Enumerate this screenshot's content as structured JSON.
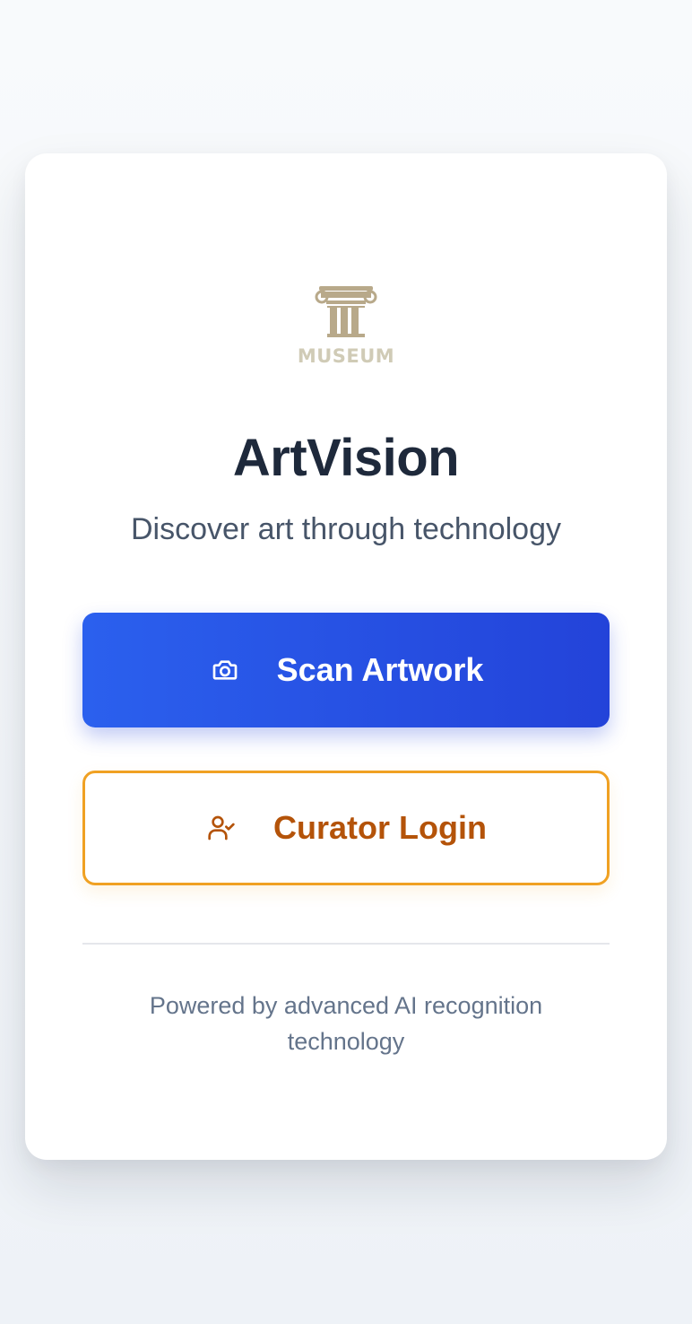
{
  "app": {
    "title": "ArtVision",
    "subtitle": "Discover art through technology"
  },
  "logo": {
    "text": "MUSEUM",
    "icon": "column-icon",
    "color": "#b8a98a"
  },
  "actions": {
    "scan": {
      "label": "Scan Artwork",
      "icon": "camera-icon"
    },
    "curator": {
      "label": "Curator Login",
      "icon": "user-check-icon"
    }
  },
  "footer": {
    "text": "Powered by advanced AI recognition technology"
  },
  "colors": {
    "primary": "#2b55e6",
    "accent": "#f0a123",
    "accent_text": "#b45309",
    "title": "#1e293b"
  }
}
